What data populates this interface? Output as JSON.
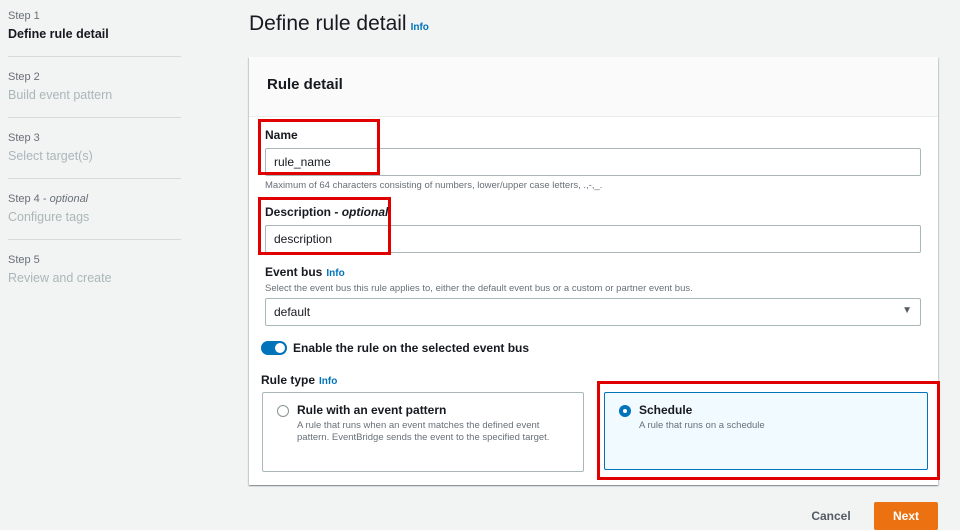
{
  "sidebar": {
    "steps": [
      {
        "num": "Step 1",
        "title": "Define rule detail"
      },
      {
        "num": "Step 2",
        "title": "Build event pattern"
      },
      {
        "num": "Step 3",
        "title": "Select target(s)"
      },
      {
        "num": "Step 4",
        "num_suffix": "optional",
        "title": "Configure tags"
      },
      {
        "num": "Step 5",
        "title": "Review and create"
      }
    ]
  },
  "page": {
    "title": "Define rule detail",
    "info": "Info"
  },
  "panel": {
    "header": "Rule detail",
    "name": {
      "label": "Name",
      "value": "rule_name",
      "hint": "Maximum of 64 characters consisting of numbers, lower/upper case letters, .,-,_."
    },
    "description": {
      "label": "Description",
      "label_suffix": "optional",
      "value": "description"
    },
    "event_bus": {
      "label": "Event bus",
      "info": "Info",
      "hint": "Select the event bus this rule applies to, either the default event bus or a custom or partner event bus.",
      "selected": "default"
    },
    "toggle": {
      "label": "Enable the rule on the selected event bus",
      "enabled": true
    },
    "rule_type": {
      "label": "Rule type",
      "info": "Info",
      "options": [
        {
          "title": "Rule with an event pattern",
          "desc": "A rule that runs when an event matches the defined event pattern. EventBridge sends the event to the specified target.",
          "selected": false
        },
        {
          "title": "Schedule",
          "desc": "A rule that runs on a schedule",
          "selected": true
        }
      ]
    }
  },
  "footer": {
    "cancel": "Cancel",
    "next": "Next"
  },
  "colors": {
    "accent": "#0073bb",
    "primary_button": "#ec7211",
    "highlight_box": "#e00000"
  }
}
